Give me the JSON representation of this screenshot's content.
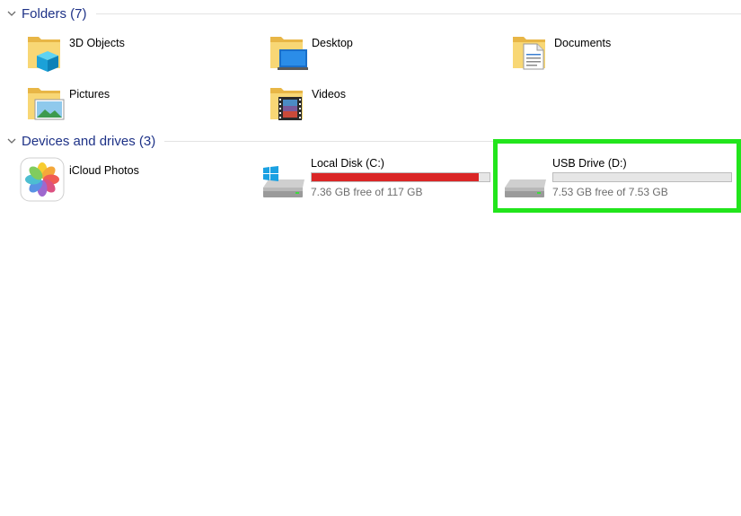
{
  "sections": {
    "folders": {
      "title": "Folders (7)",
      "items": [
        {
          "label": "3D Objects",
          "icon": "3d-objects-folder-icon"
        },
        {
          "label": "Desktop",
          "icon": "desktop-folder-icon"
        },
        {
          "label": "Documents",
          "icon": "documents-folder-icon"
        },
        {
          "label": "Pictures",
          "icon": "pictures-folder-icon"
        },
        {
          "label": "Videos",
          "icon": "videos-folder-icon"
        }
      ]
    },
    "devices": {
      "title": "Devices and drives (3)",
      "items": [
        {
          "label": "iCloud Photos",
          "icon": "icloud-photos-icon"
        }
      ],
      "drives": [
        {
          "name": "Local Disk (C:)",
          "free_text": "7.36 GB free of 117 GB",
          "used_fraction": 0.937,
          "bar_color": "#da2626",
          "icon": "windows-drive-icon"
        },
        {
          "name": "USB Drive (D:)",
          "free_text": "7.53 GB free of 7.53 GB",
          "used_fraction": 0.0,
          "bar_color": "#26a0da",
          "icon": "usb-drive-icon"
        }
      ]
    }
  },
  "highlight_color": "#22e51c"
}
